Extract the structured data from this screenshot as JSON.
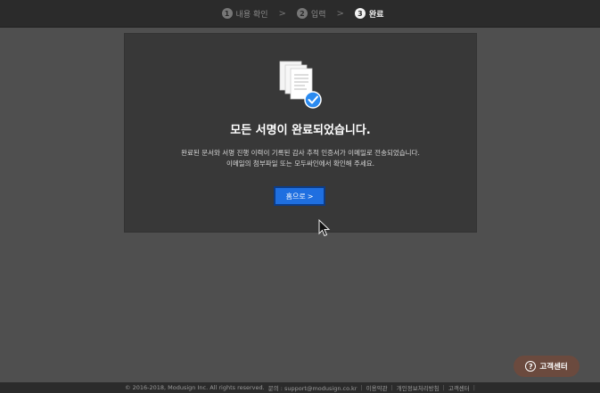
{
  "steps": [
    {
      "num": "1",
      "label": "내용 확인"
    },
    {
      "num": "2",
      "label": "입력"
    },
    {
      "num": "3",
      "label": "완료"
    }
  ],
  "step_separator": ">",
  "card": {
    "title": "모든 서명이 완료되었습니다.",
    "desc_line1": "완료된 문서와 서명 진행 이력이 기록된 감사 추적 인증서가 이메일로 전송되었습니다.",
    "desc_line2": "이메일의 첨부파일 또는 모두싸인에서 확인해 주세요.",
    "home_button_label": "홈으로",
    "home_button_chevron": ">"
  },
  "help": {
    "icon_glyph": "?",
    "label": "고객센터"
  },
  "footer": {
    "copyright": "© 2016-2018, Modusign Inc. All rights reserved.",
    "contact": "문의 : support@modusign.co.kr",
    "links": [
      "이용약관",
      "개인정보처리방침",
      "고객센터"
    ],
    "separator": "|"
  },
  "colors": {
    "accent": "#1f6fe0",
    "help_button": "#6b4a3e",
    "card_bg": "#383838",
    "page_bg": "#4f4f4f"
  }
}
